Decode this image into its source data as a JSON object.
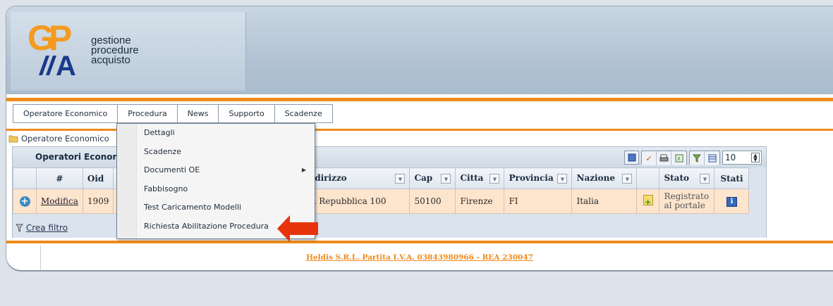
{
  "logo": {
    "letters": "GPA",
    "lines": [
      "gestione",
      "procedure",
      "acquisto"
    ]
  },
  "menu": [
    {
      "label": "Operatore Economico"
    },
    {
      "label": "Procedura"
    },
    {
      "label": "News"
    },
    {
      "label": "Supporto"
    },
    {
      "label": "Scadenze"
    }
  ],
  "breadcrumb": {
    "text": "Operatore Economico"
  },
  "grid": {
    "title": "Operatori Econor",
    "rows_per_page": "10",
    "columns": [
      "#",
      "Oid",
      "ndirizzo",
      "Cap",
      "Citta",
      "Provincia",
      "Nazione",
      "",
      "Stato",
      "Stati"
    ],
    "row": {
      "action": "Modifica",
      "oid": "1909",
      "indirizzo": "la Repubblica 100",
      "cap": "50100",
      "citta": "Firenze",
      "provincia": "FI",
      "nazione": "Italia",
      "stato_line1": "Registrato",
      "stato_line2": "al portale"
    },
    "filter_link": "Crea filtro"
  },
  "dropdown": {
    "items": [
      {
        "label": "Dettagli"
      },
      {
        "label": "Scadenze"
      },
      {
        "label": "Documenti OE",
        "submenu": true
      },
      {
        "label": "Fabbisogno"
      },
      {
        "label": "Test Caricamento Modelli"
      },
      {
        "label": "Richiesta Abilitazione Procedura"
      }
    ]
  },
  "footer": {
    "text": "Heldis S.R.L. Partita I.V.A. 03843980966 - REA 230047"
  },
  "colors": {
    "accent": "#f08a1c",
    "header": "#b3c3d3",
    "row_bg": "#fde4cd",
    "arrow": "#e8340c"
  }
}
